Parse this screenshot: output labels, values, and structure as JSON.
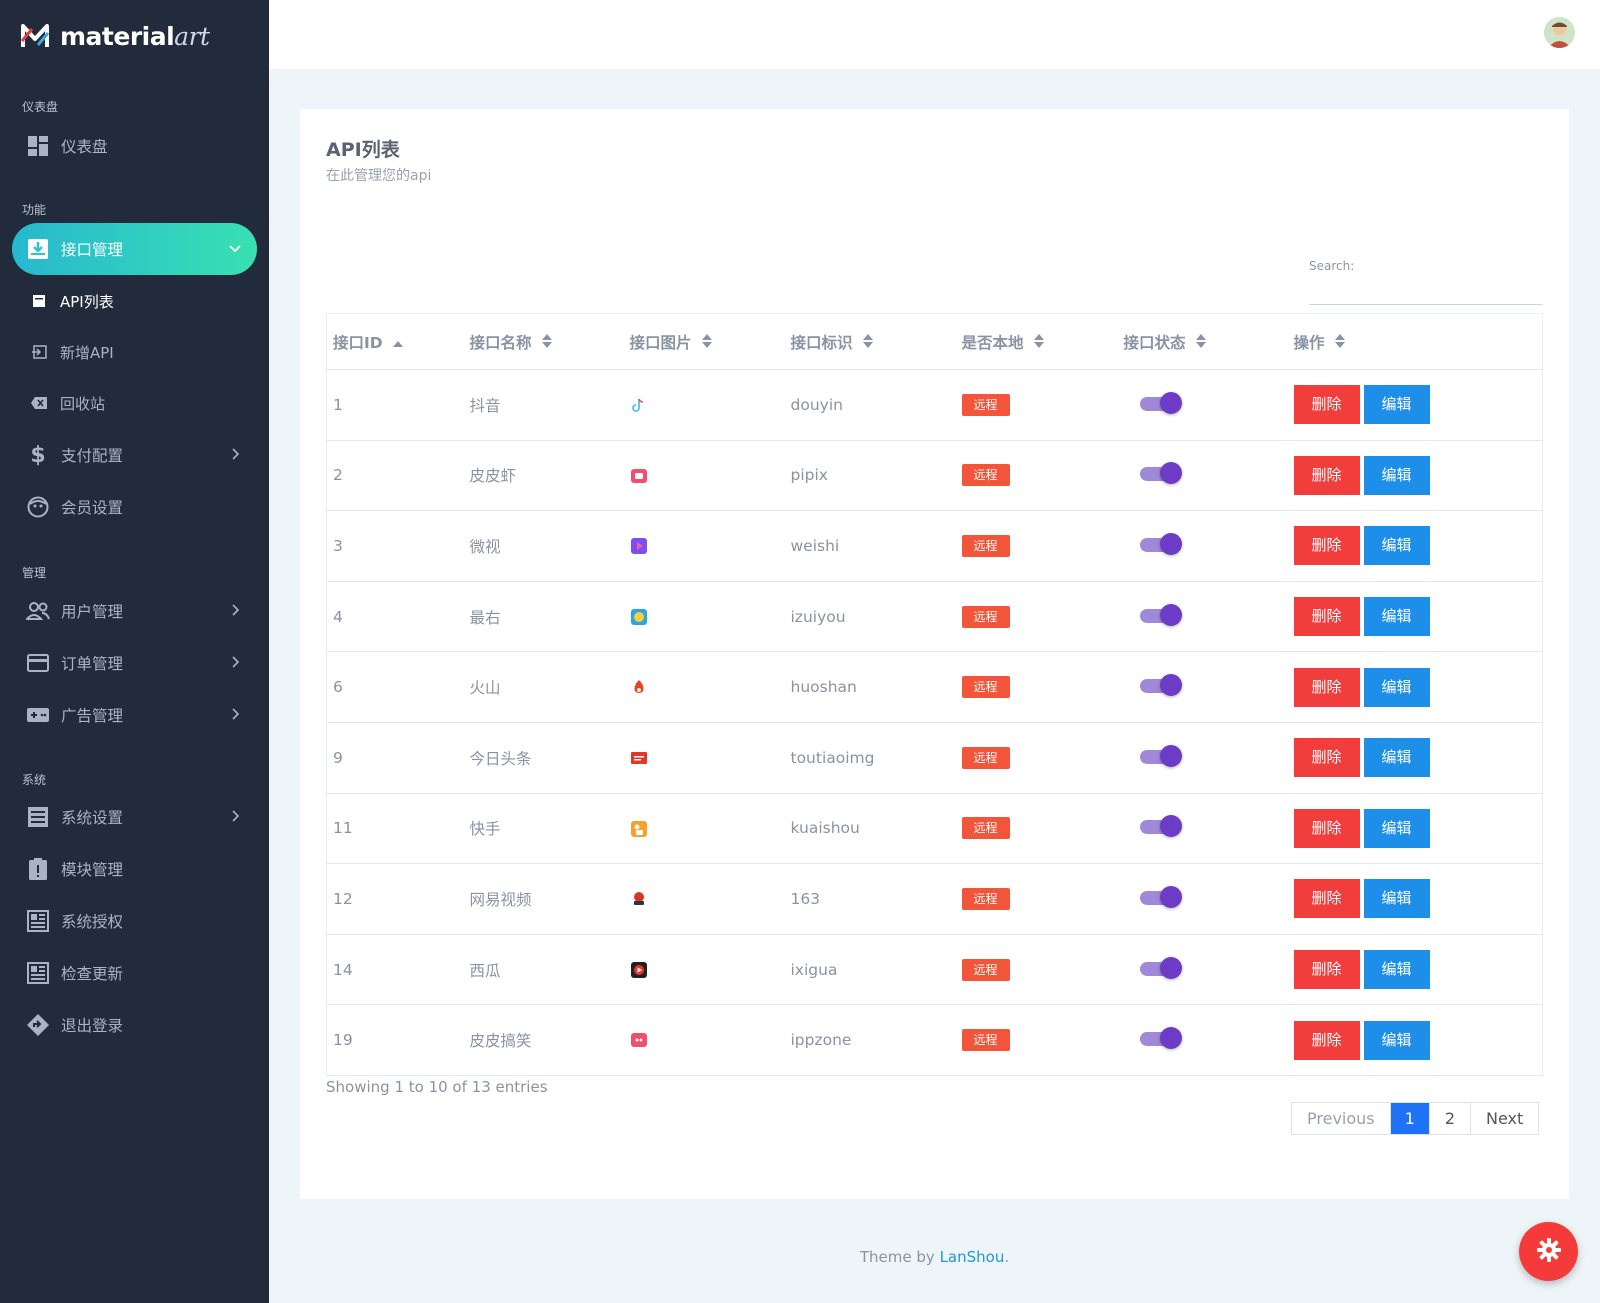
{
  "brand": {
    "name_main": "material",
    "name_art": "art"
  },
  "sidebar": {
    "sections": [
      {
        "title": "仪表盘"
      },
      {
        "title": "功能"
      },
      {
        "title": "管理"
      },
      {
        "title": "系统"
      }
    ],
    "items": [
      {
        "label": "仪表盘",
        "icon": "dashboard-icon"
      },
      {
        "label": "接口管理",
        "icon": "inbox-icon",
        "active": true
      },
      {
        "label": "API列表",
        "icon": "square-icon",
        "sub": true,
        "current": true
      },
      {
        "label": "新增API",
        "icon": "import-icon",
        "sub": true
      },
      {
        "label": "回收站",
        "icon": "backspace-icon",
        "sub": true
      },
      {
        "label": "支付配置",
        "icon": "dollar-icon"
      },
      {
        "label": "会员设置",
        "icon": "face-icon"
      },
      {
        "label": "用户管理",
        "icon": "users-icon"
      },
      {
        "label": "订单管理",
        "icon": "card-icon"
      },
      {
        "label": "广告管理",
        "icon": "gamepad-icon"
      },
      {
        "label": "系统设置",
        "icon": "list-icon"
      },
      {
        "label": "模块管理",
        "icon": "clipboard-alert-icon"
      },
      {
        "label": "系统授权",
        "icon": "grid-doc-icon"
      },
      {
        "label": "检查更新",
        "icon": "grid-doc-icon"
      },
      {
        "label": "退出登录",
        "icon": "diamond-arrow-icon"
      }
    ]
  },
  "card": {
    "title": "API列表",
    "subtitle": "在此管理您的api",
    "search_label": "Search:",
    "search_value": ""
  },
  "table": {
    "headers": [
      "接口ID",
      "接口名称",
      "接口图片",
      "接口标识",
      "是否本地",
      "接口状态",
      "操作"
    ],
    "rows": [
      {
        "id": "1",
        "name": "抖音",
        "icon": "douyin-icon",
        "tag": "douyin",
        "local": "远程"
      },
      {
        "id": "2",
        "name": "皮皮虾",
        "icon": "pipix-icon",
        "tag": "pipix",
        "local": "远程"
      },
      {
        "id": "3",
        "name": "微视",
        "icon": "weishi-icon",
        "tag": "weishi",
        "local": "远程"
      },
      {
        "id": "4",
        "name": "最右",
        "icon": "zuiyou-icon",
        "tag": "izuiyou",
        "local": "远程"
      },
      {
        "id": "6",
        "name": "火山",
        "icon": "huoshan-icon",
        "tag": "huoshan",
        "local": "远程"
      },
      {
        "id": "9",
        "name": "今日头条",
        "icon": "toutiao-icon",
        "tag": "toutiaoimg",
        "local": "远程"
      },
      {
        "id": "11",
        "name": "快手",
        "icon": "kuaishou-icon",
        "tag": "kuaishou",
        "local": "远程"
      },
      {
        "id": "12",
        "name": "网易视频",
        "icon": "netease-icon",
        "tag": "163",
        "local": "远程"
      },
      {
        "id": "14",
        "name": "西瓜",
        "icon": "xigua-icon",
        "tag": "ixigua",
        "local": "远程"
      },
      {
        "id": "19",
        "name": "皮皮搞笑",
        "icon": "pipigaoxiao-icon",
        "tag": "ippzone",
        "local": "远程"
      }
    ],
    "delete_label": "删除",
    "edit_label": "编辑"
  },
  "pagination": {
    "info": "Showing 1 to 10 of 13 entries",
    "previous": "Previous",
    "pages": [
      "1",
      "2"
    ],
    "next": "Next"
  },
  "footer": {
    "prefix": "Theme by ",
    "link": "LanShou",
    "suffix": "."
  },
  "colors": {
    "sidebar_bg": "#222b3c",
    "active_gradient_start": "#27b8d0",
    "active_gradient_end": "#39e0b2",
    "badge": "#f2553a",
    "delete": "#f23d3d",
    "edit": "#1e8fe8",
    "page_active": "#1e72f5",
    "fab": "#f53a3a"
  }
}
